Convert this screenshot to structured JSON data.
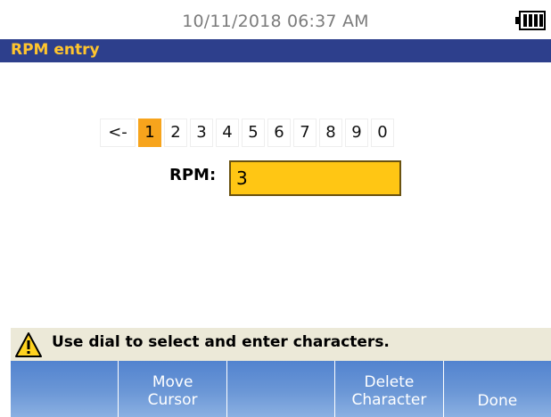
{
  "status": {
    "datetime": "10/11/2018 06:37 AM",
    "battery_icon": "battery-full-icon"
  },
  "title": "RPM entry",
  "keypad": {
    "keys": [
      "<-",
      "1",
      "2",
      "3",
      "4",
      "5",
      "6",
      "7",
      "8",
      "9",
      "0"
    ],
    "selected": "1"
  },
  "rpm": {
    "label": "RPM:",
    "value": "3"
  },
  "hint": {
    "icon": "warning-icon",
    "text": "Use dial to select and enter characters."
  },
  "softkeys": [
    {
      "line1": "",
      "line2": ""
    },
    {
      "line1": "Move",
      "line2": "Cursor"
    },
    {
      "line1": "",
      "line2": ""
    },
    {
      "line1": "Delete",
      "line2": "Character"
    },
    {
      "line1": "",
      "line2": "Done"
    }
  ],
  "colors": {
    "title_bg": "#2d3f8c",
    "title_text": "#ffc52e",
    "selected_key": "#f7a41c",
    "input_bg": "#ffc614",
    "softkey_blue": "#5283cf"
  }
}
